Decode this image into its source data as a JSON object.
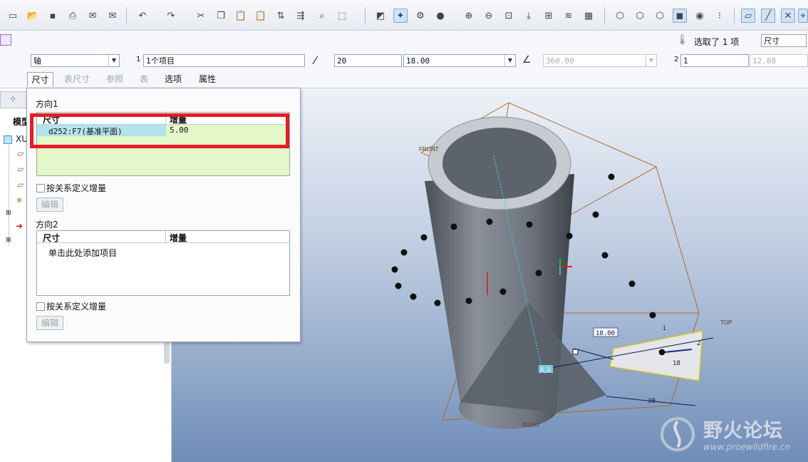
{
  "dashboard": {
    "reference_type": "轴",
    "ref_count": "1",
    "ref_items": "1个项目",
    "member_count": "20",
    "increment": "18.00",
    "angle_total": "360.00",
    "second_count_label": "2",
    "second_count": "1",
    "second_value": "12.88",
    "selected_label": "选取了 1 项",
    "filter_value": "尺寸"
  },
  "tabs": [
    "尺寸",
    "表尺寸",
    "参照",
    "表",
    "选项",
    "属性"
  ],
  "tree": {
    "tab_label": "模型",
    "root_item": "XU"
  },
  "panel": {
    "direction1": "方向1",
    "direction2": "方向2",
    "col_dimension": "尺寸",
    "col_increment": "增量",
    "row1_dimension": "d252:F7(基准平面)",
    "row1_increment": "5.00",
    "add_item_hint": "单击此处添加项目",
    "relation_checkbox": "按关系定义增量",
    "edit_button": "编辑"
  },
  "viewport": {
    "front_label": "FRONT",
    "top_label": "TOP",
    "right_label": "RIGHT",
    "axis_label": "A_1",
    "dim_18": "18.00",
    "dim_18b": "18",
    "dim_30": "30",
    "dim_2": "2",
    "dim_1": "1"
  },
  "watermark": {
    "name": "野火论坛",
    "url": "www.proewildfire.cn"
  },
  "colors": {
    "highlight": "#e51c23",
    "selected_row": "#b3e4ec",
    "table_bg": "#e4f7c8"
  }
}
